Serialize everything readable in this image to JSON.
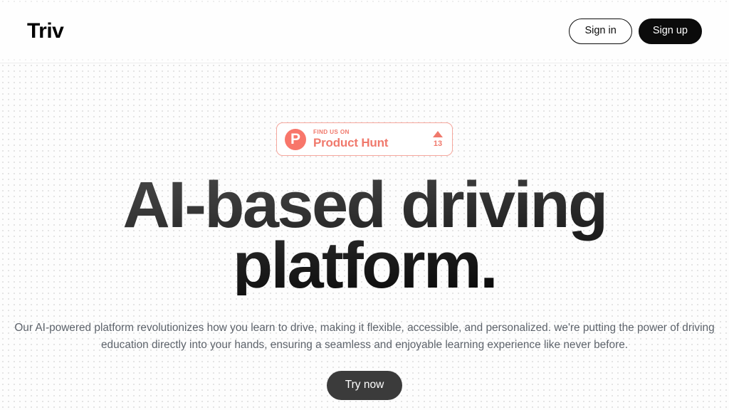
{
  "header": {
    "logo": "Triv",
    "sign_in_label": "Sign in",
    "sign_up_label": "Sign up"
  },
  "hero": {
    "badge": {
      "logo_letter": "P",
      "kicker": "FIND US ON",
      "title": "Product Hunt",
      "upvote_count": "13"
    },
    "headline": "AI-based driving platform.",
    "subcopy": "Our AI-powered platform revolutionizes how you learn to drive, making it flexible, accessible, and personalized. we're putting the power of driving education directly into your hands, ensuring a seamless and enjoyable learning experience like never before.",
    "cta_label": "Try now"
  },
  "colors": {
    "brand_black": "#0b0b0b",
    "product_hunt_coral": "#f8766a",
    "product_hunt_text": "#f0796c",
    "product_hunt_border": "#f6a79d",
    "cta_background": "#3b3b3b",
    "body_text": "#5d636b",
    "page_background": "#fdfdfd",
    "dot_grid": "#dcdcdc",
    "header_border": "#ededed"
  }
}
